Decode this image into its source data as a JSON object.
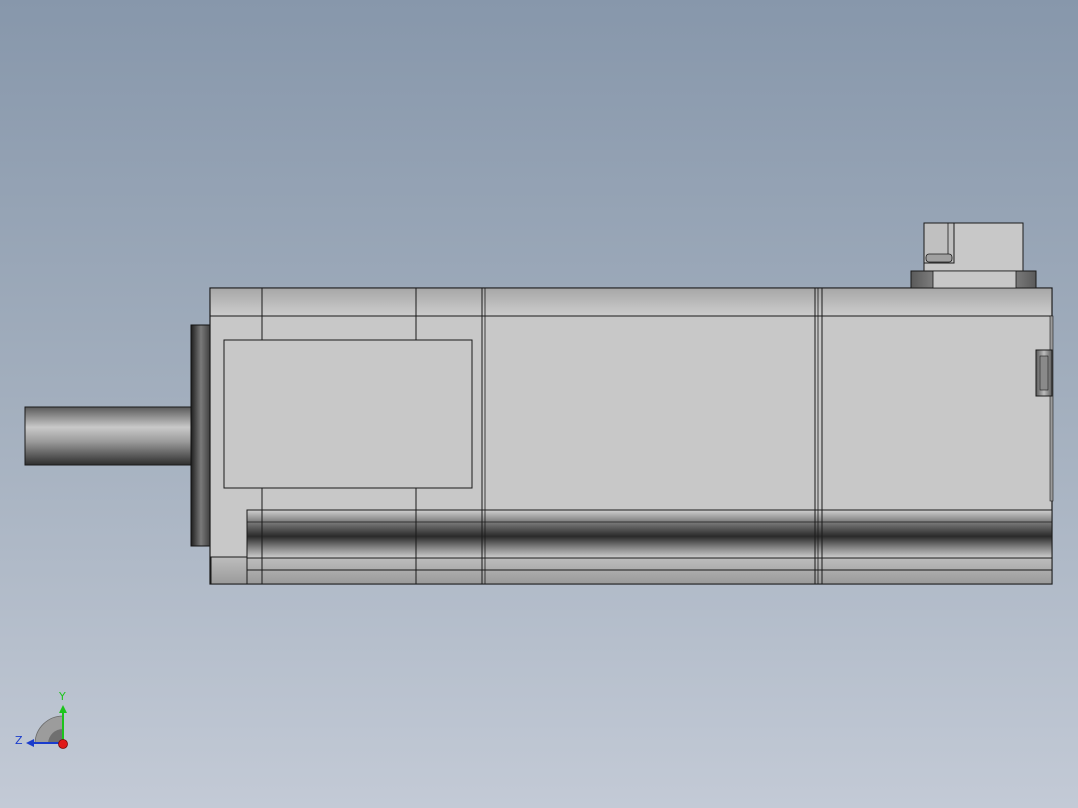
{
  "viewport": {
    "background_top": "#8797ab",
    "background_bottom": "#c3cad6"
  },
  "model": {
    "body_color": "#c8c8c8",
    "edge_color": "#1a1a1a"
  },
  "triad": {
    "y_label": "Y",
    "z_label": "Z",
    "y_color": "#1cc41c",
    "z_color": "#1a3ccc",
    "x_color": "#e01818"
  }
}
